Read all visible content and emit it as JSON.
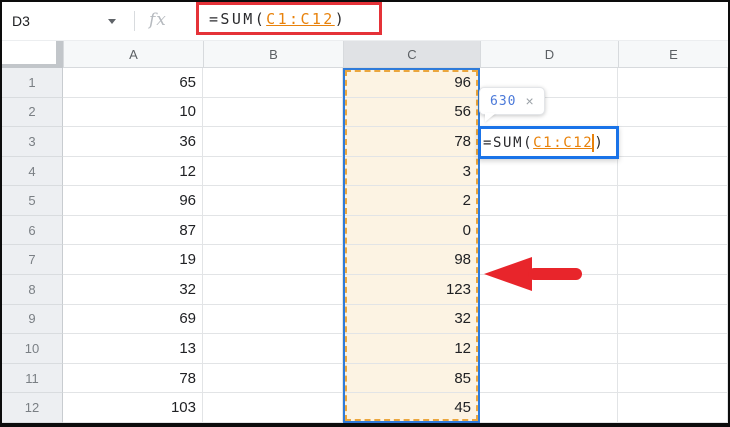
{
  "toolbar": {
    "name_box_value": "D3",
    "fx_label": "fx",
    "formula": {
      "prefix": "=SUM(",
      "range": "C1:C12",
      "suffix": ")"
    }
  },
  "grid": {
    "column_headers": [
      "A",
      "B",
      "C",
      "D",
      "E"
    ],
    "highlighted_column": "C",
    "rows": [
      {
        "row": "1",
        "values": {
          "A": "65",
          "C": "96"
        }
      },
      {
        "row": "2",
        "values": {
          "A": "10",
          "C": "56"
        }
      },
      {
        "row": "3",
        "values": {
          "A": "36",
          "C": "78"
        }
      },
      {
        "row": "4",
        "values": {
          "A": "12",
          "C": "3"
        }
      },
      {
        "row": "5",
        "values": {
          "A": "96",
          "C": "2"
        }
      },
      {
        "row": "6",
        "values": {
          "A": "87",
          "C": "0"
        }
      },
      {
        "row": "7",
        "values": {
          "A": "19",
          "C": "98"
        }
      },
      {
        "row": "8",
        "values": {
          "A": "32",
          "C": "123"
        }
      },
      {
        "row": "9",
        "values": {
          "A": "69",
          "C": "32"
        }
      },
      {
        "row": "10",
        "values": {
          "A": "13",
          "C": "12"
        }
      },
      {
        "row": "11",
        "values": {
          "A": "78",
          "C": "85"
        }
      },
      {
        "row": "12",
        "values": {
          "A": "103",
          "C": "45"
        }
      }
    ]
  },
  "cell_editor": {
    "cell": "D3",
    "prefix": "=SUM(",
    "range": "C1:C12",
    "suffix": ")"
  },
  "tooltip": {
    "value": "630",
    "close_label": "×"
  },
  "colors": {
    "formula_box_red": "#e53238",
    "arrow_red": "#e8252b",
    "range_reference_orange": "#e8820c",
    "range_dashed_border": "#eba63d",
    "range_fill_beige": "#fcf3e3",
    "editor_border_blue": "#1a73e8",
    "range_outer_blue": "#2f7bd9",
    "preview_value_blue": "#4b79d9"
  }
}
